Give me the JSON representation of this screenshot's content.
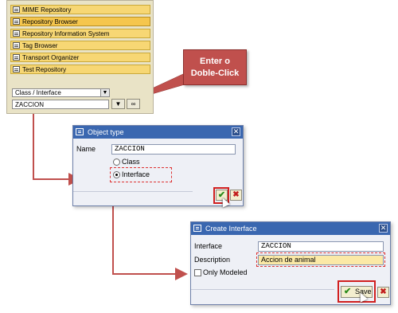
{
  "sidebar": {
    "items": [
      {
        "label": "MIME Repository",
        "icon": "mime-icon"
      },
      {
        "label": "Repository Browser",
        "icon": "repository-browser-icon"
      },
      {
        "label": "Repository Information System",
        "icon": "info-system-icon"
      },
      {
        "label": "Tag Browser",
        "icon": "tag-browser-icon"
      },
      {
        "label": "Transport Organizer",
        "icon": "transport-icon"
      },
      {
        "label": "Test Repository",
        "icon": "test-repository-icon"
      }
    ],
    "object_list_value": "Class / Interface",
    "name_value": "ZACCION"
  },
  "callout": {
    "line1": "Enter o",
    "line2": "Doble-Click"
  },
  "object_type_dialog": {
    "title": "Object type",
    "name_label": "Name",
    "name_value": "ZACCION",
    "option_class": "Class",
    "option_interface": "Interface",
    "selected": "Interface"
  },
  "create_interface_dialog": {
    "title": "Create Interface",
    "interface_label": "Interface",
    "interface_value": "ZACCION",
    "description_label": "Description",
    "description_value": "Accion de animal",
    "only_modeled_label": "Only Modeled",
    "save_label": "Save"
  },
  "colors": {
    "callout": "#c0504d",
    "title_bar": "#3a67b0",
    "arrow": "#c0504d",
    "highlight": "#d11f1f"
  }
}
